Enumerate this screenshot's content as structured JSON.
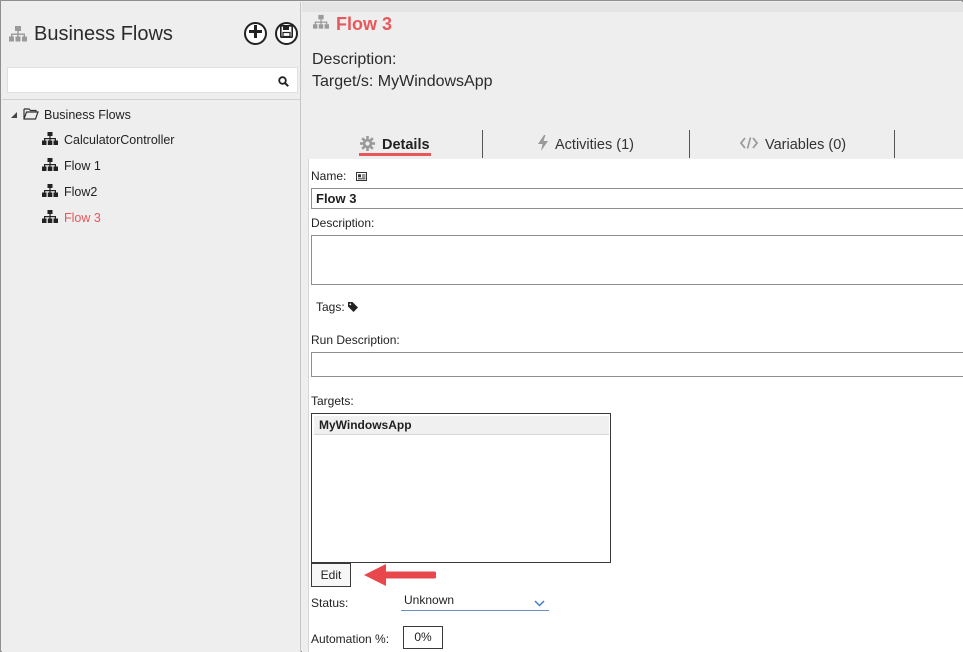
{
  "left_panel": {
    "title": "Business Flows",
    "search": {
      "value": "",
      "placeholder": ""
    },
    "tree": {
      "root_label": "Business Flows",
      "items": [
        {
          "label": "CalculatorController"
        },
        {
          "label": "Flow 1"
        },
        {
          "label": "Flow2"
        },
        {
          "label": "Flow 3",
          "selected": true
        }
      ]
    }
  },
  "header": {
    "title": "Flow 3",
    "description_label": "Description:",
    "targets_line": "Target/s: MyWindowsApp"
  },
  "tabs": [
    {
      "label": "Details",
      "icon": "gear-icon",
      "active": true
    },
    {
      "label": "Activities (1)",
      "icon": "bolt-icon",
      "active": false
    },
    {
      "label": "Variables (0)",
      "icon": "code-icon",
      "active": false
    }
  ],
  "details": {
    "name_label": "Name:",
    "name_value": "Flow 3",
    "description_label": "Description:",
    "description_value": "",
    "tags_label": "Tags:",
    "run_description_label": "Run Description:",
    "run_description_value": "",
    "targets_label": "Targets:",
    "targets": [
      "MyWindowsApp"
    ],
    "edit_label": "Edit",
    "status_label": "Status:",
    "status_value": "Unknown",
    "automation_label": "Automation %:",
    "automation_value": "0%"
  },
  "colors": {
    "accent": "#e8575a",
    "arrow": "#e8474c"
  }
}
